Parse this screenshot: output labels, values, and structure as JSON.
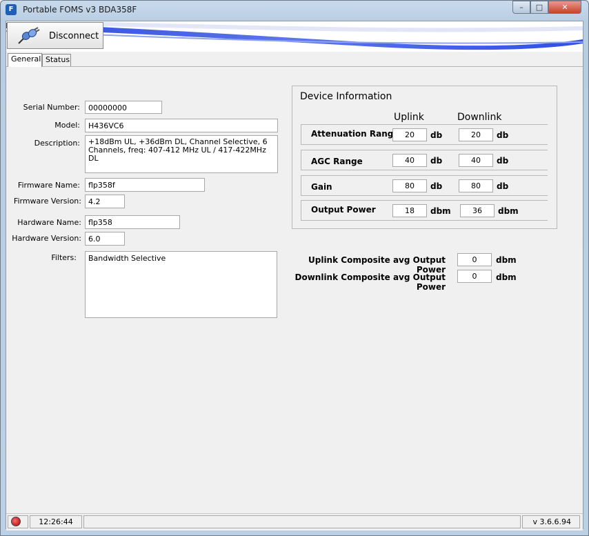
{
  "window": {
    "title": "Portable FOMS v3 BDA358F",
    "min_symbol": "–",
    "max_symbol": "□",
    "close_symbol": "✕"
  },
  "toolbar": {
    "disconnect_label": "Disconnect"
  },
  "tabs": [
    {
      "label": "General"
    },
    {
      "label": "Status"
    }
  ],
  "general": {
    "serial_label": "Serial Number:",
    "serial_value": "00000000",
    "model_label": "Model:",
    "model_value": "H436VC6",
    "description_label": "Description:",
    "description_value": "+18dBm UL, +36dBm DL, Channel Selective, 6\nChannels, freq: 407-412 MHz UL / 417-422MHz DL",
    "fw_name_label": "Firmware Name:",
    "fw_name_value": "flp358f",
    "fw_version_label": "Firmware Version:",
    "fw_version_value": "4.2",
    "hw_name_label": "Hardware Name:",
    "hw_name_value": "flp358",
    "hw_version_label": "Hardware Version:",
    "hw_version_value": "6.0",
    "filters_label": "Filters:",
    "filters_value": "Bandwidth Selective"
  },
  "device_info": {
    "title": "Device Information",
    "uplink_header": "Uplink",
    "downlink_header": "Downlink",
    "rows": [
      {
        "label": "Attenuation Range",
        "uplink": "20",
        "uplink_unit": "db",
        "downlink": "20",
        "downlink_unit": "db"
      },
      {
        "label": "AGC Range",
        "uplink": "40",
        "uplink_unit": "db",
        "downlink": "40",
        "downlink_unit": "db"
      },
      {
        "label": "Gain",
        "uplink": "80",
        "uplink_unit": "db",
        "downlink": "80",
        "downlink_unit": "db"
      },
      {
        "label": "Output Power",
        "uplink": "18",
        "uplink_unit": "dbm",
        "downlink": "36",
        "downlink_unit": "dbm"
      }
    ]
  },
  "composite": {
    "uplink_label": "Uplink Composite avg Output Power",
    "uplink_value": "0",
    "uplink_unit": "dbm",
    "downlink_label": "Downlink Composite avg Output Power",
    "downlink_value": "0",
    "downlink_unit": "dbm"
  },
  "statusbar": {
    "time": "12:26:44",
    "message": "",
    "version": "v 3.6.6.94"
  }
}
